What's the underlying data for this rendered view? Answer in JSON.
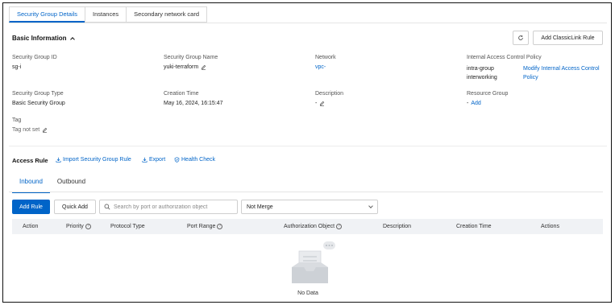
{
  "tabs": [
    "Security Group Details",
    "Instances",
    "Secondary network card"
  ],
  "basic_info": {
    "title": "Basic Information",
    "add_classiclink_label": "Add ClassicLink Rule",
    "fields": {
      "sg_id": {
        "label": "Security Group ID",
        "value": "sg-i"
      },
      "sg_name": {
        "label": "Security Group Name",
        "value": "yuki-terraform"
      },
      "network": {
        "label": "Network",
        "value": "vpc-"
      },
      "iac_policy": {
        "label": "Internal Access Control Policy",
        "value_line1": "intra-group",
        "value_line2": "interworking",
        "action_line1": "Modify Internal Access Control",
        "action_line2": "Policy"
      },
      "sg_type": {
        "label": "Security Group Type",
        "value": "Basic Security Group"
      },
      "creation_time": {
        "label": "Creation Time",
        "value": "May 16, 2024, 16:15:47"
      },
      "description": {
        "label": "Description",
        "value": "-"
      },
      "resource_group": {
        "label": "Resource Group",
        "value": "-",
        "action": "Add"
      },
      "tag": {
        "label": "Tag",
        "value": "Tag not set"
      }
    }
  },
  "access_rule": {
    "title": "Access Rule",
    "import_label": "Import Security Group Rule",
    "export_label": "Export",
    "health_check_label": "Health Check",
    "subtabs": [
      "Inbound",
      "Outbound"
    ],
    "add_rule_label": "Add Rule",
    "quick_add_label": "Quick Add",
    "search_placeholder": "Search by port or authorization object",
    "merge_select_value": "Not Merge",
    "columns": [
      "Action",
      "Priority",
      "Protocol Type",
      "Port Range",
      "Authorization Object",
      "Description",
      "Creation Time",
      "Actions"
    ],
    "empty_text": "No Data"
  },
  "colors": {
    "accent": "#0064c8",
    "header_bg": "#f0f2f5"
  }
}
